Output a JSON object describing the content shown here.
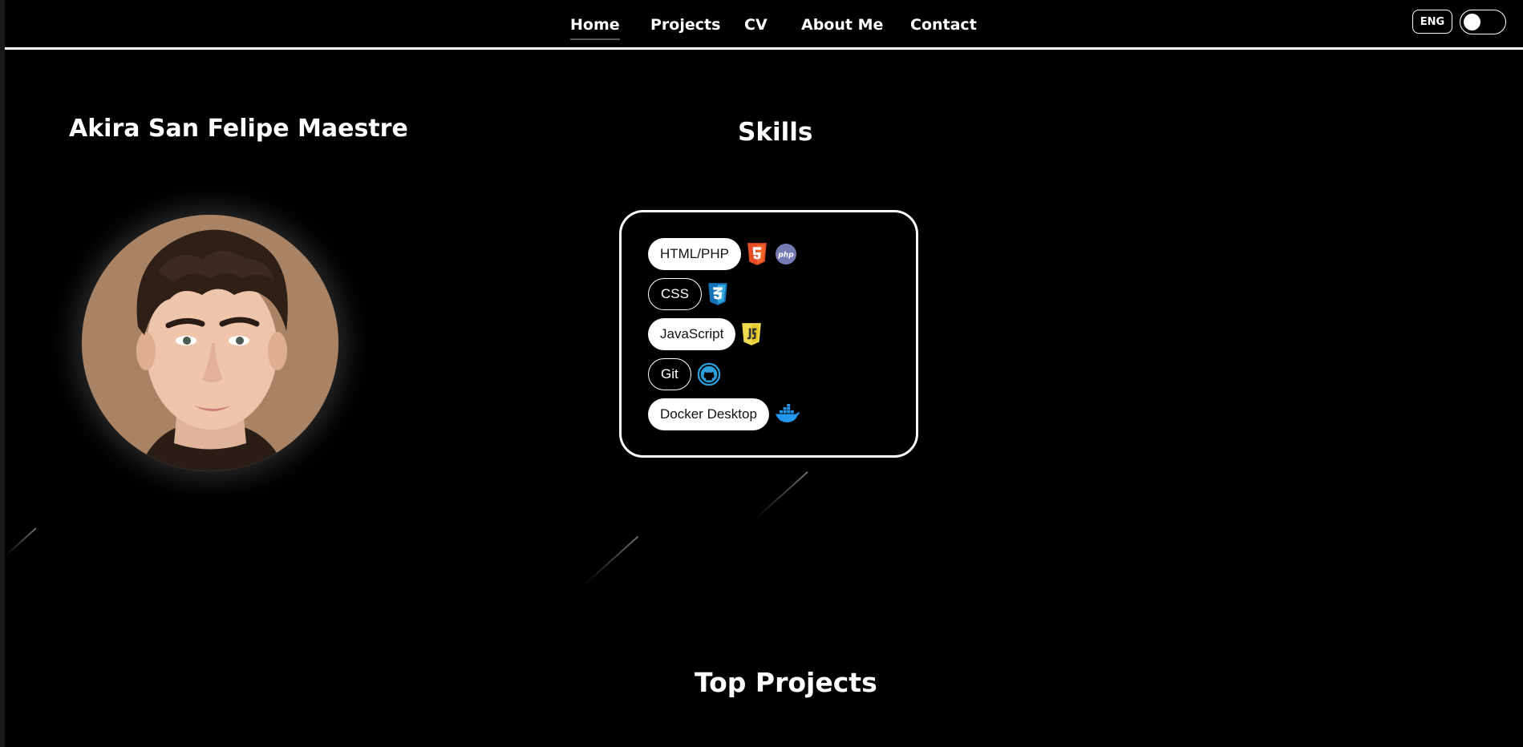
{
  "nav": {
    "links": [
      {
        "label": "Home"
      },
      {
        "label": "Projects"
      },
      {
        "label": "CV"
      },
      {
        "label": "About Me"
      },
      {
        "label": "Contact"
      }
    ],
    "active_link": "Home",
    "language_label": "ENG"
  },
  "profile": {
    "name": "Akira San Felipe Maestre"
  },
  "skills": {
    "title": "Skills",
    "items": [
      {
        "label": "HTML/PHP",
        "style": "filled",
        "icons": [
          "html5-icon",
          "php-icon"
        ]
      },
      {
        "label": "CSS",
        "style": "outline",
        "icons": [
          "css3-icon"
        ]
      },
      {
        "label": "JavaScript",
        "style": "filled",
        "icons": [
          "javascript-icon"
        ]
      },
      {
        "label": "Git",
        "style": "outline",
        "icons": [
          "github-icon"
        ]
      },
      {
        "label": "Docker Desktop",
        "style": "filled",
        "icons": [
          "docker-icon"
        ]
      }
    ]
  },
  "projects": {
    "title": "Top Projects"
  },
  "colors": {
    "background": "#000000",
    "foreground": "#ffffff",
    "html5": "#e44d26",
    "php": "#777bb3",
    "css3": "#1572b6",
    "javascript": "#f0db4f",
    "github": "#2d9cdb",
    "docker": "#2496ed"
  }
}
